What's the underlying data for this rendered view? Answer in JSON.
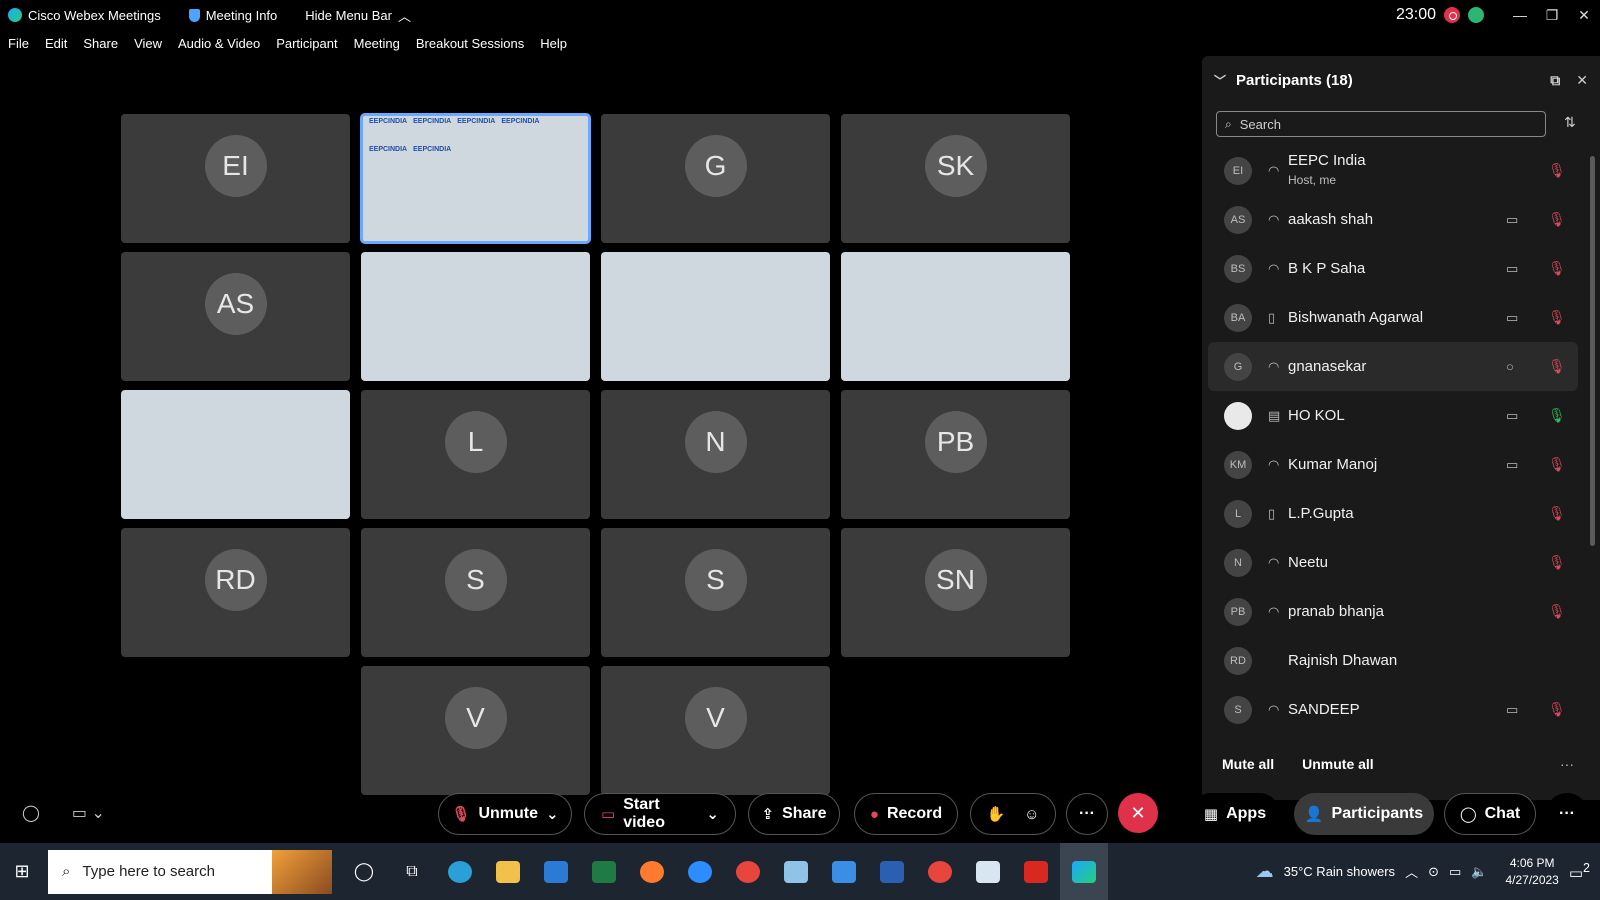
{
  "titlebar": {
    "app_title": "Cisco Webex Meetings",
    "meeting_info": "Meeting Info",
    "hide_menu": "Hide Menu Bar",
    "time": "23:00",
    "minimize": "—",
    "restore": "❐",
    "close": "✕"
  },
  "menu": [
    "File",
    "Edit",
    "Share",
    "View",
    "Audio & Video",
    "Participant",
    "Meeting",
    "Breakout Sessions",
    "Help"
  ],
  "grid": {
    "tiles": [
      {
        "initials": "EI"
      },
      {
        "initials": "",
        "video": true,
        "active": true
      },
      {
        "initials": "G"
      },
      {
        "initials": "SK"
      },
      {
        "initials": "AS"
      },
      {
        "initials": "",
        "video": true
      },
      {
        "initials": "",
        "video": true
      },
      {
        "initials": "",
        "video": true
      },
      {
        "initials": "",
        "video": true
      },
      {
        "initials": "L"
      },
      {
        "initials": "N"
      },
      {
        "initials": "PB"
      },
      {
        "initials": "RD"
      },
      {
        "initials": "S"
      },
      {
        "initials": "S"
      },
      {
        "initials": "SN"
      },
      {
        "initials": "V"
      },
      {
        "initials": "V"
      }
    ],
    "banner_text": "EEPCINDIA"
  },
  "participants_panel": {
    "title": "Participants (18)",
    "search_placeholder": "Search",
    "rows": [
      {
        "initials": "EI",
        "name": "EEPC India",
        "sub": "Host, me",
        "device": "headset-icon",
        "cam": false,
        "mic": "muted"
      },
      {
        "initials": "AS",
        "name": "aakash shah",
        "device": "headset-icon",
        "cam": true,
        "mic": "muted"
      },
      {
        "initials": "BS",
        "name": "B K P Saha",
        "device": "headset-icon",
        "cam": true,
        "mic": "muted"
      },
      {
        "initials": "BA",
        "name": "Bishwanath Agarwal",
        "device": "phone-icon",
        "cam": true,
        "mic": "muted"
      },
      {
        "initials": "G",
        "name": "gnanasekar",
        "device": "headset-icon",
        "cam": false,
        "chat": true,
        "mic": "muted",
        "highlight": true
      },
      {
        "initials": "",
        "name": "HO KOL",
        "device": "room-device-icon",
        "cam": true,
        "mic": "on",
        "white": true
      },
      {
        "initials": "KM",
        "name": "Kumar Manoj",
        "device": "headset-icon",
        "cam": true,
        "mic": "muted"
      },
      {
        "initials": "L",
        "name": "L.P.Gupta",
        "device": "phone-icon",
        "cam": false,
        "mic": "muted"
      },
      {
        "initials": "N",
        "name": "Neetu",
        "device": "headset-icon",
        "cam": false,
        "mic": "muted"
      },
      {
        "initials": "PB",
        "name": "pranab bhanja",
        "device": "headset-icon",
        "cam": false,
        "mic": "muted"
      },
      {
        "initials": "RD",
        "name": "Rajnish Dhawan",
        "device": "",
        "cam": false,
        "mic": ""
      },
      {
        "initials": "S",
        "name": "SANDEEP",
        "device": "headset-icon",
        "cam": true,
        "mic": "muted"
      }
    ],
    "mute_all": "Mute all",
    "unmute_all": "Unmute all",
    "more": "···"
  },
  "controls": {
    "unmute": "Unmute",
    "start_video": "Start video",
    "share": "Share",
    "record": "Record",
    "more": "···",
    "apps": "Apps",
    "participants": "Participants",
    "chat": "Chat",
    "overflow": "···"
  },
  "taskbar": {
    "search_placeholder": "Type here to search",
    "weather": "35°C  Rain showers",
    "time": "4:06 PM",
    "date": "4/27/2023",
    "notif_count": "2"
  },
  "colors": {
    "accent_red": "#e0314b",
    "mic_on": "#2fbf5c",
    "active_outline": "#6aa9ff"
  }
}
